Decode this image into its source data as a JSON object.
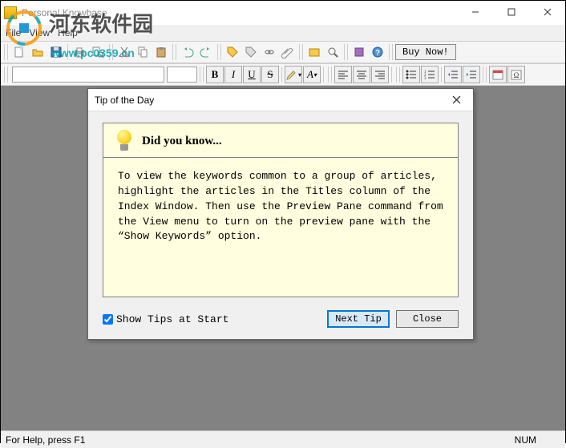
{
  "window": {
    "title": "Personal Knowbase",
    "controls": {
      "min": "–",
      "max": "☐",
      "close": "✕"
    }
  },
  "menu": {
    "file": "File",
    "view": "View",
    "help": "Help"
  },
  "toolbar": {
    "buy_now": "Buy Now!"
  },
  "format": {
    "bold": "B",
    "italic": "I",
    "underline": "U",
    "strike": "S",
    "font_a": "A"
  },
  "dialog": {
    "title": "Tip of the Day",
    "heading": "Did you know...",
    "body": "To view the keywords common to a group of articles, highlight the articles in the Titles column of the Index Window. Then use the Preview Pane command from the View menu to turn on the preview pane with the “Show Keywords” option.",
    "show_tips": "Show Tips at Start",
    "next_tip": "Next Tip",
    "close": "Close"
  },
  "status": {
    "help": "For Help, press F1",
    "num": "NUM"
  },
  "watermark": {
    "line1": "河东软件园",
    "line2": "www.pc0359.cn"
  }
}
